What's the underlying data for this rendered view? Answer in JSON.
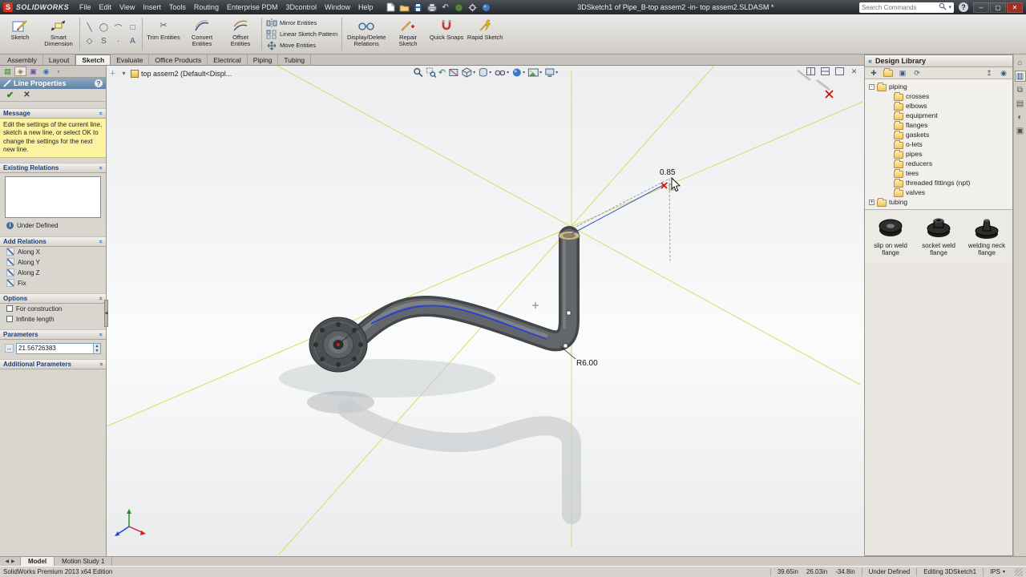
{
  "colors": {
    "brand_red": "#d3311e",
    "construction_line_yellow": "#d8d855",
    "selected_sketch_blue": "#2440d8",
    "message_bg_yellow": "#fbf3a0"
  },
  "titlebar": {
    "logo_text": "SOLIDWORKS",
    "menus": [
      "File",
      "Edit",
      "View",
      "Insert",
      "Tools",
      "Routing",
      "Enterprise PDM",
      "3Dcontrol",
      "Window",
      "Help"
    ],
    "doc_title": "3DSketch1 of Pipe_B-top assem2 -in- top assem2.SLDASM *",
    "search_placeholder": "Search Commands"
  },
  "ribbon": {
    "tabs": [
      {
        "label": "Assembly"
      },
      {
        "label": "Layout"
      },
      {
        "label": "Sketch",
        "active": true
      },
      {
        "label": "Evaluate"
      },
      {
        "label": "Office Products"
      },
      {
        "label": "Electrical"
      },
      {
        "label": "Piping"
      },
      {
        "label": "Tubing"
      }
    ],
    "buttons": {
      "sketch": "Sketch",
      "smart_dimension": "Smart Dimension",
      "trim": "Trim Entities",
      "convert": "Convert Entities",
      "offset": "Offset Entities",
      "mirror": "Mirror Entities",
      "linear_pattern": "Linear Sketch Pattern",
      "move": "Move Entities",
      "display_delete": "Display/Delete Relations",
      "repair": "Repair Sketch",
      "quick_snaps": "Quick Snaps",
      "rapid": "Rapid Sketch"
    },
    "entity_tools": [
      {
        "name": "line",
        "glyph": "╲"
      },
      {
        "name": "circle",
        "glyph": "◯"
      },
      {
        "name": "arc",
        "glyph": "⌒"
      },
      {
        "name": "rectangle",
        "glyph": "□"
      },
      {
        "name": "polygon",
        "glyph": "◇"
      },
      {
        "name": "spline",
        "glyph": "S"
      },
      {
        "name": "point",
        "glyph": "·"
      },
      {
        "name": "text",
        "glyph": "A"
      }
    ]
  },
  "property_manager": {
    "title": "Line Properties",
    "message": {
      "header": "Message",
      "text": "Edit the settings of the current line, sketch a new line, or select OK to change the settings for the next new line."
    },
    "existing_relations": {
      "header": "Existing Relations",
      "status": "Under Defined"
    },
    "add_relations": {
      "header": "Add Relations",
      "items": [
        "Along X",
        "Along Y",
        "Along Z",
        "Fix"
      ]
    },
    "options": {
      "header": "Options",
      "checkboxes": [
        "For construction",
        "Infinite length"
      ]
    },
    "parameters": {
      "header": "Parameters",
      "value": "21.56726383"
    },
    "additional_parameters": {
      "header": "Additional Parameters"
    }
  },
  "viewport": {
    "flyout_tree_label": "top assem2 (Default<Displ...",
    "dim_radius": "R6.00",
    "dim_length": "0.85"
  },
  "design_library": {
    "title": "Design Library",
    "tree": [
      {
        "label": "piping",
        "level": 1,
        "twisty": "-"
      },
      {
        "label": "crosses",
        "level": 2
      },
      {
        "label": "elbows",
        "level": 2
      },
      {
        "label": "equipment",
        "level": 2
      },
      {
        "label": "flanges",
        "level": 2
      },
      {
        "label": "gaskets",
        "level": 2
      },
      {
        "label": "o-lets",
        "level": 2
      },
      {
        "label": "pipes",
        "level": 2
      },
      {
        "label": "reducers",
        "level": 2
      },
      {
        "label": "tees",
        "level": 2
      },
      {
        "label": "threaded fittings (npt)",
        "level": 2
      },
      {
        "label": "valves",
        "level": 2
      },
      {
        "label": "tubing",
        "level": 1,
        "twisty": "+"
      }
    ],
    "items": [
      {
        "label": "slip on weld flange"
      },
      {
        "label": "socket weld flange"
      },
      {
        "label": "welding neck flange"
      }
    ]
  },
  "bottom_tabs": {
    "model": "Model",
    "motion_study": "Motion Study 1"
  },
  "status_bar": {
    "left": "SolidWorks Premium 2013 x64 Edition",
    "coord_x": "39.65in",
    "coord_y": "26.03in",
    "coord_z": "-34.8in",
    "state": "Under Defined",
    "editing": "Editing 3DSketch1",
    "units": "IPS"
  }
}
